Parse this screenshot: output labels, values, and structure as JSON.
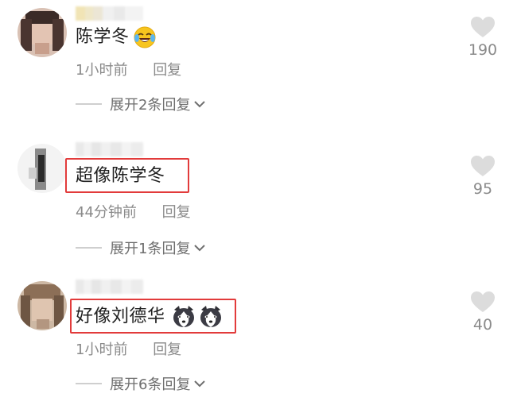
{
  "comments": [
    {
      "text": "陈学冬",
      "emoji": "laughing-tears-emoji",
      "time": "1小时前",
      "reply": "回复",
      "expand": "展开2条回复",
      "likes": "190",
      "highlighted": false
    },
    {
      "text": "超像陈学冬",
      "emoji": "",
      "time": "44分钟前",
      "reply": "回复",
      "expand": "展开1条回复",
      "likes": "95",
      "highlighted": true
    },
    {
      "text": "好像刘德华",
      "emoji": "husky-dog-emoji x2",
      "time": "1小时前",
      "reply": "回复",
      "expand": "展开6条回复",
      "likes": "40",
      "highlighted": true
    }
  ],
  "colors": {
    "highlight": "#e23b3b",
    "heart": "#dcdcdc",
    "meta_text": "#8a8a8a"
  }
}
